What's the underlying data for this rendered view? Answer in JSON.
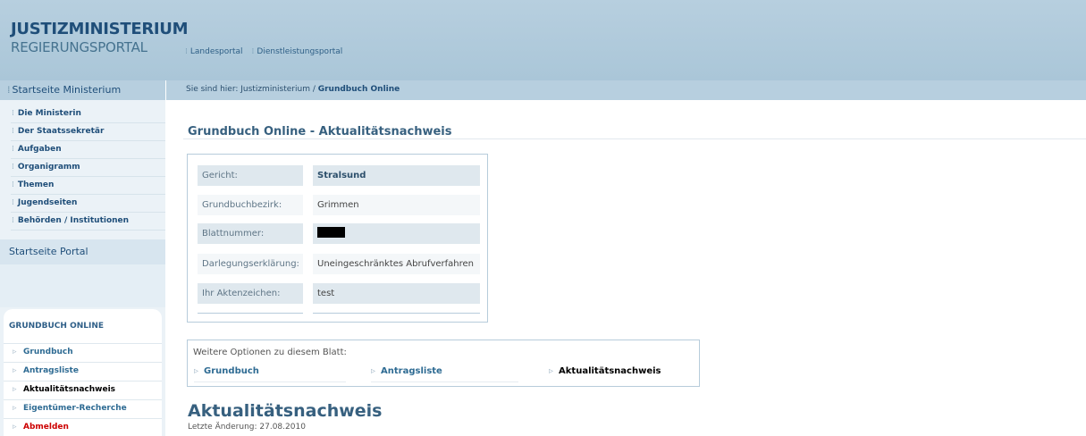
{
  "header": {
    "logo_line1": "JUSTIZMINISTERIUM",
    "logo_line2": "REGIERUNGSPORTAL",
    "toplinks": [
      "Landesportal",
      "Dienstleistungsportal"
    ]
  },
  "sidebar": {
    "home_label": "Startseite Ministerium",
    "items": [
      {
        "label": "Die Ministerin"
      },
      {
        "label": "Der Staatssekretär"
      },
      {
        "label": "Aufgaben"
      },
      {
        "label": "Organigramm"
      },
      {
        "label": "Themen"
      },
      {
        "label": "Jugendseiten"
      },
      {
        "label": "Behörden / Institutionen"
      }
    ],
    "portal_label": "Startseite Portal",
    "grundbuch": {
      "title": "GRUNDBUCH ONLINE",
      "items": [
        {
          "label": "Grundbuch"
        },
        {
          "label": "Antragsliste"
        },
        {
          "label": "Aktualitätsnachweis"
        },
        {
          "label": "Eigentümer-Recherche"
        },
        {
          "label": "Abmelden"
        }
      ]
    }
  },
  "breadcrumb": {
    "prefix": "Sie sind hier: Justizministerium / ",
    "current": "Grundbuch Online"
  },
  "main": {
    "title": "Grundbuch Online - Aktualitätsnachweis",
    "info": [
      {
        "label": "Gericht:",
        "value": "Stralsund"
      },
      {
        "label": "Grundbuchbezirk:",
        "value": "Grimmen"
      },
      {
        "label": "Blattnummer:",
        "value": ""
      },
      {
        "label": "Darlegungserklärung:",
        "value": "Uneingeschränktes Abrufverfahren"
      },
      {
        "label": "Ihr Aktenzeichen:",
        "value": "test"
      }
    ],
    "options": {
      "title": "Weitere Optionen zu diesem Blatt:",
      "links": [
        {
          "label": "Grundbuch"
        },
        {
          "label": "Antragsliste"
        },
        {
          "label": "Aktualitätsnachweis"
        }
      ]
    },
    "section_title": "Aktualitätsnachweis",
    "last_change": "Letzte Änderung: 27.08.2010"
  }
}
